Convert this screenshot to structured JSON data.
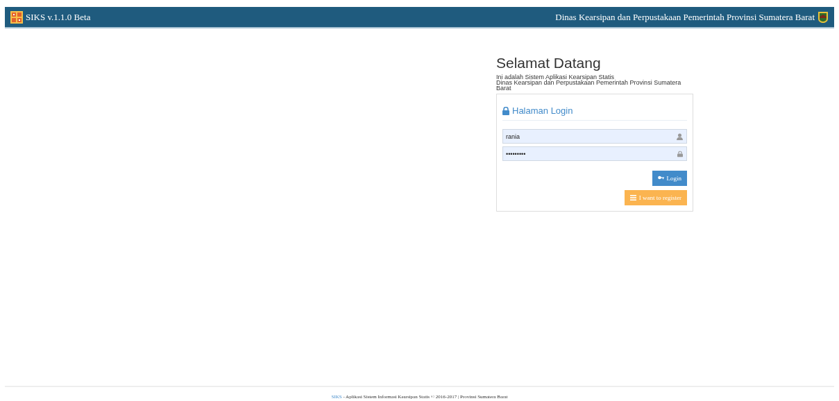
{
  "navbar": {
    "brand": "SIKS v.1.1.0 Beta",
    "agency": "Dinas Kearsipan dan Perpustakaan Pemerintah Provinsi Sumatera Barat"
  },
  "welcome": {
    "title": "Selamat Datang",
    "lines": [
      "Ini adalah Sistem Aplikasi Kearsipan Statis",
      "Dinas Kearsipan dan Perpustakaan Pemerintah Provinsi Sumatera Barat"
    ]
  },
  "login_panel": {
    "heading": "Halaman Login",
    "username": {
      "value": "rania"
    },
    "password": {
      "value": "•••••••••"
    },
    "login_button": "Login",
    "register_button": "I want to register"
  },
  "footer": {
    "link": "SIKS",
    "text": " - Aplikasi Sistem Informasi Kearsipan Statis © 2016-2017 | Provinsi Sumatera Barat"
  }
}
